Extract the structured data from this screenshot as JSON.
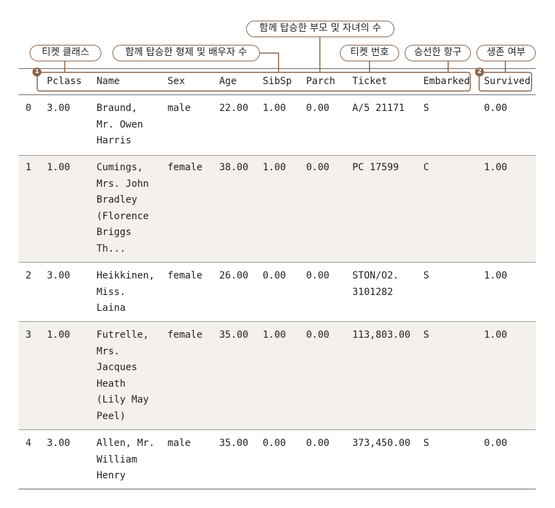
{
  "callouts": {
    "pclass": "티켓 클래스",
    "sibsp": "함께 탑승한 형제 및 배우자 수",
    "parch": "함께 탑승한 부모 및 자녀의 수",
    "ticket": "티켓 번호",
    "embarked": "승선한 항구",
    "survived": "생존 여부"
  },
  "badges": [
    "1",
    "2"
  ],
  "columns": [
    "Pclass",
    "Name",
    "Sex",
    "Age",
    "SibSp",
    "Parch",
    "Ticket",
    "Embarked",
    "Survived"
  ],
  "rows": [
    {
      "index": "0",
      "pclass": "3.00",
      "name": "Braund,\nMr. Owen\nHarris",
      "sex": "male",
      "age": "22.00",
      "sibsp": "1.00",
      "parch": "0.00",
      "ticket": "A/5 21171",
      "embarked": "S",
      "survived": "0.00"
    },
    {
      "index": "1",
      "pclass": "1.00",
      "name": "Cumings,\nMrs. John\nBradley\n(Florence\nBriggs\nTh...",
      "sex": "female",
      "age": "38.00",
      "sibsp": "1.00",
      "parch": "0.00",
      "ticket": "PC 17599",
      "embarked": "C",
      "survived": "1.00"
    },
    {
      "index": "2",
      "pclass": "3.00",
      "name": "Heikkinen,\nMiss.\nLaina",
      "sex": "female",
      "age": "26.00",
      "sibsp": "0.00",
      "parch": "0.00",
      "ticket": "STON/O2.\n3101282",
      "embarked": "S",
      "survived": "1.00"
    },
    {
      "index": "3",
      "pclass": "1.00",
      "name": "Futrelle,\nMrs.\nJacques\nHeath\n(Lily May\nPeel)",
      "sex": "female",
      "age": "35.00",
      "sibsp": "1.00",
      "parch": "0.00",
      "ticket": "113,803.00",
      "embarked": "S",
      "survived": "1.00"
    },
    {
      "index": "4",
      "pclass": "3.00",
      "name": "Allen, Mr.\nWilliam\nHenry",
      "sex": "male",
      "age": "35.00",
      "sibsp": "0.00",
      "parch": "0.00",
      "ticket": "373,450.00",
      "embarked": "S",
      "survived": "0.00"
    }
  ],
  "colors": {
    "accent": "#8a6549",
    "band": "#f4f0eb",
    "rule": "#9a9a9a"
  }
}
